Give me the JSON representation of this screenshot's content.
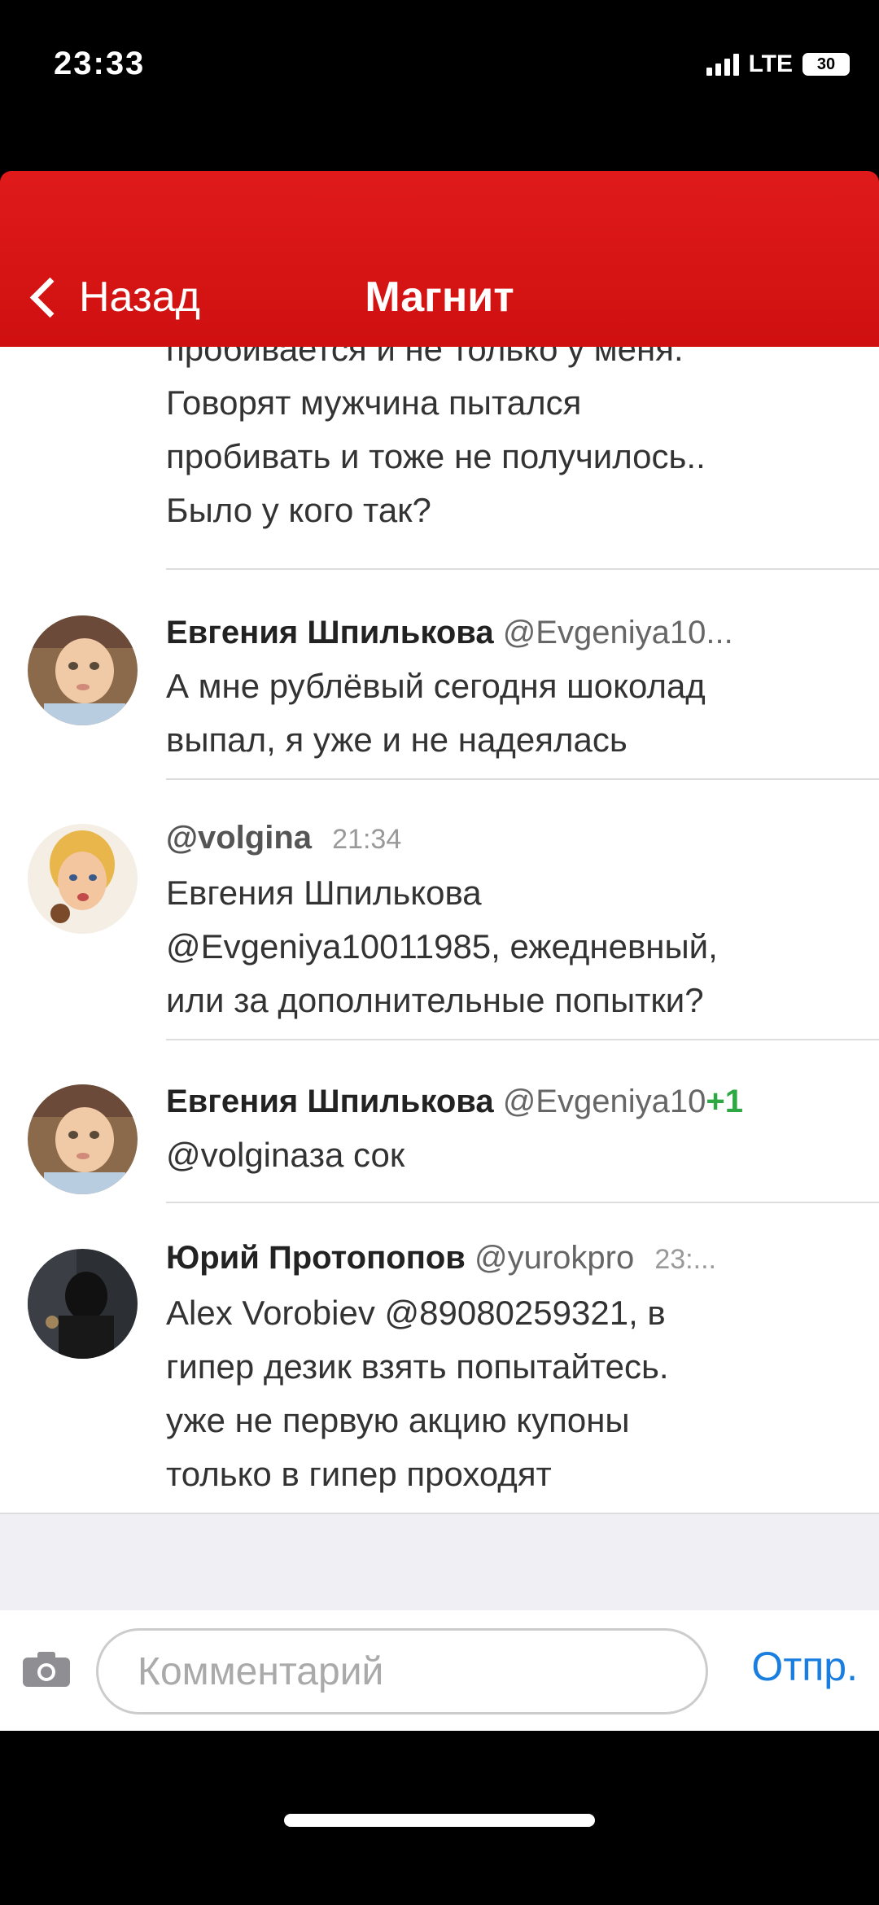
{
  "status_bar": {
    "time": "23:33",
    "network": "LTE",
    "battery": "30"
  },
  "nav": {
    "back_label": "Назад",
    "title": "Магнит"
  },
  "partial_comment": {
    "lines": [
      "пробивается и не только у меня.",
      "Говорят мужчина пытался",
      "пробивать и тоже не получилось..",
      "Было у кого так?"
    ]
  },
  "comments": [
    {
      "name": "Евгения Шпилькова",
      "handle": "@Evgeniya10...",
      "time": "",
      "lines": [
        "А мне рублёвый сегодня шоколад",
        "выпал, я уже и не надеялась"
      ]
    },
    {
      "name": "",
      "handle": "@volgina",
      "time": "21:34",
      "lines": [
        "Евгения Шпилькова",
        "@Evgeniya10011985, ежедневный,",
        "или за дополнительные попытки?"
      ]
    },
    {
      "name": "Евгения Шпилькова",
      "handle": "@Evgeniya10+1",
      "time": "",
      "lines": [
        "@volginaза сок"
      ]
    },
    {
      "name": "Юрий Протопопов",
      "handle": "@yurokpro",
      "time": "23:...",
      "lines": [
        "Alex Vorobiev @89080259321, в",
        "гипер дезик взять попытайтесь.",
        "уже не первую акцию купоны",
        "только в гипер проходят"
      ]
    }
  ],
  "composer": {
    "placeholder": "Комментарий",
    "send_label": "Отпр."
  },
  "colors": {
    "header_red": "#d81414",
    "send_blue": "#1a7de0",
    "plus_green": "#2ea843"
  }
}
